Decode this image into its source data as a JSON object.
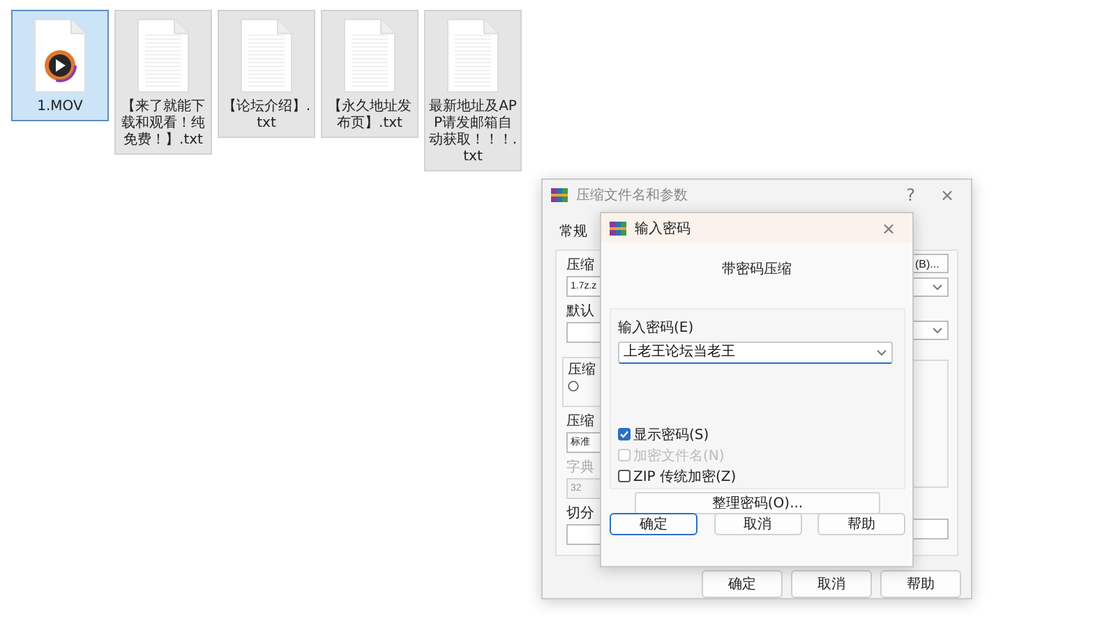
{
  "desktop_files": [
    {
      "name": "1.MOV",
      "kind": "video",
      "selected": true
    },
    {
      "name": "【来了就能下载和观看！纯免费！】.txt",
      "kind": "text",
      "selected": false
    },
    {
      "name": "【论坛介绍】.txt",
      "kind": "text",
      "selected": false
    },
    {
      "name": "【永久地址发布页】.txt",
      "kind": "text",
      "selected": false
    },
    {
      "name": "最新地址及APP请发邮箱自动获取！！！.txt",
      "kind": "text",
      "selected": false
    }
  ],
  "archive_dialog": {
    "title": "压缩文件名和参数",
    "help": "?",
    "close": "×",
    "tab": "常规",
    "left_column": [
      {
        "kind": "label",
        "text": "压缩",
        "disabled": false
      },
      {
        "kind": "combo",
        "text": "1.7z.z"
      },
      {
        "kind": "label",
        "text": "默认",
        "disabled": false
      },
      {
        "kind": "combo"
      },
      {
        "kind": "group",
        "text": "压缩",
        "checked": false
      },
      {
        "kind": "label",
        "text": "压缩",
        "disabled": false
      },
      {
        "kind": "combo",
        "text": "标准"
      },
      {
        "kind": "label",
        "text": "字典",
        "disabled": true
      },
      {
        "kind": "field",
        "text": "32",
        "disabled": true
      },
      {
        "kind": "label",
        "text": "切分",
        "disabled": false
      },
      {
        "kind": "field",
        "disabled": false
      }
    ],
    "right_column": [
      {
        "kind": "button",
        "text": "(B)..."
      },
      {
        "kind": "combo"
      },
      {
        "kind": "combo"
      },
      {
        "kind": "panel"
      },
      {
        "kind": "field"
      }
    ],
    "buttons": [
      "确定",
      "取消",
      "帮助"
    ]
  },
  "password_dialog": {
    "title": "输入密码",
    "close": "×",
    "heading": "带密码压缩",
    "password_label": "输入密码(E)",
    "password_value": "上老王论坛当老王",
    "options": [
      {
        "label": "显示密码(S)",
        "checked": true,
        "disabled": false
      },
      {
        "label": "加密文件名(N)",
        "checked": false,
        "disabled": true
      },
      {
        "label": "ZIP 传统加密(Z)",
        "checked": false,
        "disabled": false
      }
    ],
    "organize_button": "整理密码(O)...",
    "buttons": [
      {
        "label": "确定",
        "default": true
      },
      {
        "label": "取消",
        "default": false
      },
      {
        "label": "帮助",
        "default": false
      }
    ]
  }
}
